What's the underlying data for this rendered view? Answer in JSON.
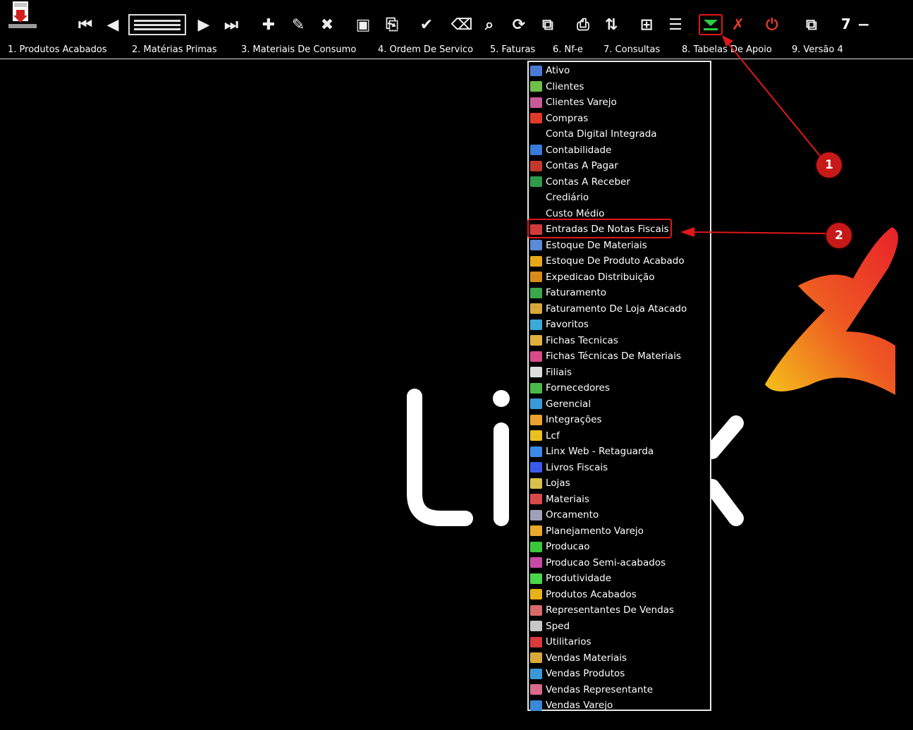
{
  "toolbar": {
    "page_indicator": "7",
    "icons": [
      "first-record-icon",
      "previous-record-icon",
      "record-list-icon",
      "next-record-icon",
      "last-record-icon",
      "add-icon",
      "edit-icon",
      "delete-icon",
      "save-icon",
      "copy-icon",
      "confirm-icon",
      "clear-icon",
      "search-icon",
      "refresh-icon",
      "preview-icon",
      "print-icon",
      "sort-icon",
      "export-icon",
      "report-icon",
      "modules-icon",
      "cancel-icon",
      "power-icon",
      "switch-window-icon"
    ]
  },
  "menu": {
    "items": [
      {
        "label": "1. Produtos Acabados"
      },
      {
        "label": "2. Matérias Primas"
      },
      {
        "label": "3. Materiais De Consumo"
      },
      {
        "label": "4. Ordem De Servico"
      },
      {
        "label": "5. Faturas"
      },
      {
        "label": "6. Nf-e"
      },
      {
        "label": "7. Consultas"
      },
      {
        "label": "8. Tabelas De Apoio"
      },
      {
        "label": "9. Versão 4"
      }
    ]
  },
  "modules": {
    "items": [
      {
        "label": "Ativo",
        "color": "#4a7bd4"
      },
      {
        "label": "Clientes",
        "color": "#6fbf4a"
      },
      {
        "label": "Clientes Varejo",
        "color": "#c85a9a"
      },
      {
        "label": "Compras",
        "color": "#e03a2a"
      },
      {
        "label": "Conta Digital Integrada",
        "color": ""
      },
      {
        "label": "Contabilidade",
        "color": "#3a7ad8"
      },
      {
        "label": "Contas A Pagar",
        "color": "#c0392b"
      },
      {
        "label": "Contas A Receber",
        "color": "#2e9a4a"
      },
      {
        "label": "Crediário",
        "color": ""
      },
      {
        "label": "Custo Médio",
        "color": ""
      },
      {
        "label": "Entradas De Notas Fiscais",
        "color": "#d23a3a"
      },
      {
        "label": "Estoque De Materiais",
        "color": "#5a8ad8"
      },
      {
        "label": "Estoque De Produto Acabado",
        "color": "#e5a81a"
      },
      {
        "label": "Expedicao Distribuição",
        "color": "#d88a1a"
      },
      {
        "label": "Faturamento",
        "color": "#3aa84a"
      },
      {
        "label": "Faturamento De Loja Atacado",
        "color": "#d8a83a"
      },
      {
        "label": "Favoritos",
        "color": "#3aaad8"
      },
      {
        "label": "Fichas Tecnicas",
        "color": "#e0b040"
      },
      {
        "label": "Fichas Técnicas De Materiais",
        "color": "#d84a8a"
      },
      {
        "label": "Filiais",
        "color": "#dddddd"
      },
      {
        "label": "Fornecedores",
        "color": "#4ab84a"
      },
      {
        "label": "Gerencial",
        "color": "#3a9ad8"
      },
      {
        "label": "Integrações",
        "color": "#e8a030"
      },
      {
        "label": "Lcf",
        "color": "#e8c020"
      },
      {
        "label": "Linx Web - Retaguarda",
        "color": "#3a88e8"
      },
      {
        "label": "Livros Fiscais",
        "color": "#3a5ae8"
      },
      {
        "label": "Lojas",
        "color": "#d8c04a"
      },
      {
        "label": "Materiais",
        "color": "#d84a4a"
      },
      {
        "label": "Orcamento",
        "color": "#a0a0b8"
      },
      {
        "label": "Planejamento Varejo",
        "color": "#e8a82a"
      },
      {
        "label": "Producao",
        "color": "#3ac83a"
      },
      {
        "label": "Producao Semi-acabados",
        "color": "#c84aa8"
      },
      {
        "label": "Produtividade",
        "color": "#4ad84a"
      },
      {
        "label": "Produtos Acabados",
        "color": "#e8b01a"
      },
      {
        "label": "Representantes De Vendas",
        "color": "#d86a6a"
      },
      {
        "label": "Sped",
        "color": "#c8c8c8"
      },
      {
        "label": "Utilitarios",
        "color": "#d83a3a"
      },
      {
        "label": "Vendas Materiais",
        "color": "#d8a83a"
      },
      {
        "label": "Vendas Produtos",
        "color": "#3a98d8"
      },
      {
        "label": "Vendas Representante",
        "color": "#d86a8a"
      },
      {
        "label": "Vendas Varejo",
        "color": "#3a88d8"
      }
    ]
  },
  "callouts": [
    "1",
    "2"
  ],
  "colors": {
    "highlight": "#e01818",
    "background": "#000000",
    "brand_gradient_start": "#f5c21a",
    "brand_gradient_end": "#e8202a"
  }
}
